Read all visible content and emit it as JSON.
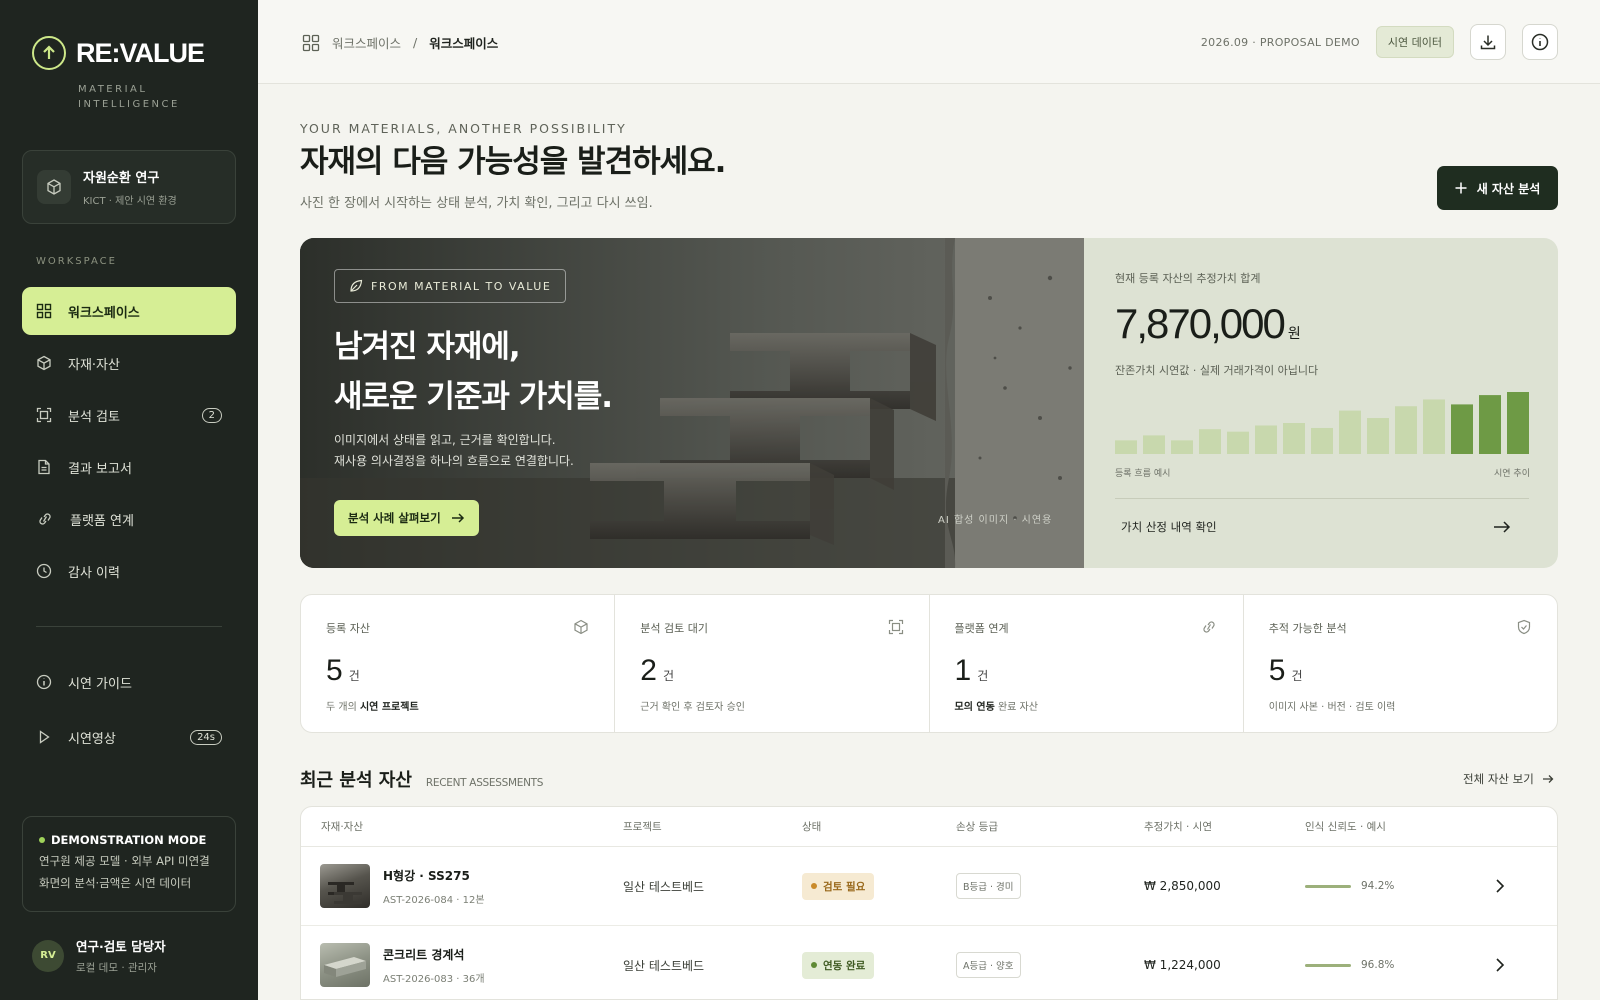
{
  "brand": {
    "name": "RE:VALUE",
    "tagline": "MATERIAL INTELLIGENCE"
  },
  "org": {
    "name": "자원순환 연구",
    "sub": "KICT · 제안 시연 환경"
  },
  "sidebar": {
    "section_label": "WORKSPACE",
    "items": [
      {
        "label": "워크스페이스",
        "icon": "grid-icon"
      },
      {
        "label": "자재·자산",
        "icon": "box-icon"
      },
      {
        "label": "분석 검토",
        "icon": "scan-icon",
        "badge": "2"
      },
      {
        "label": "결과 보고서",
        "icon": "document-icon"
      },
      {
        "label": "플랫폼 연계",
        "icon": "link-icon"
      },
      {
        "label": "감사 이력",
        "icon": "clock-icon"
      }
    ],
    "bottom_items": [
      {
        "label": "시연 가이드",
        "icon": "info-icon"
      },
      {
        "label": "시연영상",
        "icon": "play-icon",
        "badge": "24s"
      }
    ],
    "demo": {
      "title": "DEMONSTRATION MODE",
      "line1": "연구원 제공 모델 · 외부 API 미연결",
      "line2": "화면의 분석·금액은 시연 데이터"
    },
    "user": {
      "initials": "RV",
      "name": "연구·검토 담당자",
      "role": "로컬 데모 · 관리자"
    }
  },
  "topbar": {
    "breadcrumb_root": "워크스페이스",
    "breadcrumb_sep": "/",
    "breadcrumb_current": "워크스페이스",
    "meta": "2026.09 · PROPOSAL DEMO",
    "demo_pill": "시연 데이터"
  },
  "header": {
    "eyebrow": "YOUR MATERIALS, ANOTHER POSSIBILITY",
    "title": "자재의 다음 가능성을 발견하세요.",
    "subtitle": "사진 한 장에서 시작하는 상태 분석, 가치 확인, 그리고 다시 쓰임.",
    "new_button": "새 자산 분석"
  },
  "hero": {
    "tag": "FROM MATERIAL TO VALUE",
    "title_line1": "남겨진 자재에,",
    "title_line2": "새로운 기준과 가치를.",
    "desc_line1": "이미지에서 상태를 읽고, 근거를 확인합니다.",
    "desc_line2": "재사용 의사결정을 하나의 흐름으로 연결합니다.",
    "cta": "분석 사례 살펴보기",
    "caption": "AI 합성 이미지 · 시연용"
  },
  "value_panel": {
    "label": "현재 등록 자산의 추정가치 합계",
    "amount": "7,870,000",
    "unit": "원",
    "note": "잔존가치 시연값 · 실제 거래가격이 아닙니다",
    "bar_levels": [
      0.22,
      0.3,
      0.22,
      0.4,
      0.36,
      0.46,
      0.5,
      0.42,
      0.7,
      0.58,
      0.77,
      0.88,
      0.8,
      0.95,
      1.0
    ],
    "bar_colors": [
      "#c8d8ad",
      "#c8d8ad",
      "#c8d8ad",
      "#c8d8ad",
      "#c8d8ad",
      "#c8d8ad",
      "#c8d8ad",
      "#c8d8ad",
      "#c8d8ad",
      "#c8d8ad",
      "#c8d8ad",
      "#c8d8ad",
      "#6e9a45",
      "#6e9a45",
      "#6e9a45"
    ],
    "axis_left": "등록 흐름 예시",
    "axis_right": "시연 추이",
    "link": "가치 산정 내역 확인"
  },
  "stats": [
    {
      "label": "등록 자산",
      "value": "5",
      "unit": "건",
      "foot_pre": "두 개의 ",
      "foot_bold": "시연 프로젝트",
      "foot_post": "",
      "icon": "box-icon"
    },
    {
      "label": "분석 검토 대기",
      "value": "2",
      "unit": "건",
      "foot_pre": "근거 확인 후 검토자 승인",
      "foot_bold": "",
      "foot_post": "",
      "icon": "scan-icon"
    },
    {
      "label": "플랫폼 연계",
      "value": "1",
      "unit": "건",
      "foot_pre": "",
      "foot_bold": "모의 연동",
      "foot_post": " 완료 자산",
      "icon": "link-icon"
    },
    {
      "label": "추적 가능한 분석",
      "value": "5",
      "unit": "건",
      "foot_pre": "이미지 사본 · 버전 · 검토 이력",
      "foot_bold": "",
      "foot_post": "",
      "icon": "shield-icon"
    }
  ],
  "recent": {
    "title": "최근 분석 자산",
    "subtitle": "RECENT ASSESSMENTS",
    "view_all": "전체 자산 보기",
    "columns": [
      "자재·자산",
      "프로젝트",
      "상태",
      "손상 등급",
      "추정가치 · 시연",
      "인식 신뢰도 · 예시"
    ],
    "rows": [
      {
        "name": "H형강 · SS275",
        "id": "AST-2026-084 · 12본",
        "project": "일산 테스트베드",
        "status": "검토 필요",
        "status_bg": "#f6ead2",
        "status_fg": "#9a6a1d",
        "status_dot": "#c98a2a",
        "grade": "B등급 · 경미",
        "value": "₩ 2,850,000",
        "confidence": "94.2%"
      },
      {
        "name": "콘크리트 경계석",
        "id": "AST-2026-083 · 36개",
        "project": "일산 테스트베드",
        "status": "연동 완료",
        "status_bg": "#e4ecd6",
        "status_fg": "#3f5a22",
        "status_dot": "#5f8a34",
        "grade": "A등급 · 양호",
        "value": "₩ 1,224,000",
        "confidence": "96.8%"
      }
    ]
  }
}
